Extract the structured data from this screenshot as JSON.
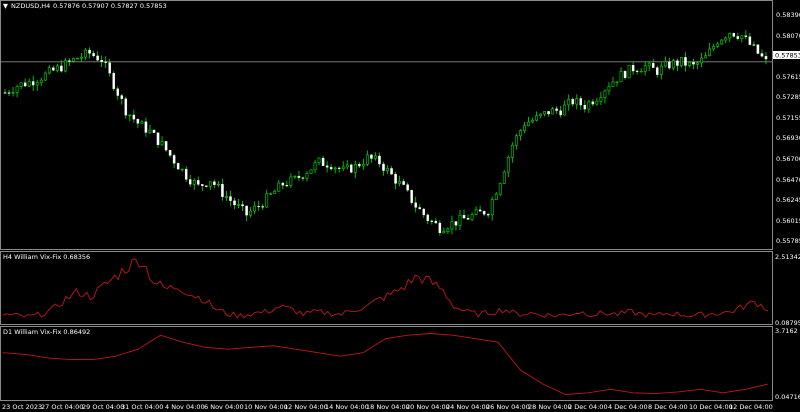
{
  "main": {
    "title": "NZDUSD,H4",
    "ohlc": "0.57876 0.57907 0.57827 0.57853",
    "price_axis": [
      "0.58390",
      "0.58070",
      "0.57615",
      "0.57285",
      "0.57155",
      "0.56930",
      "0.56700",
      "0.56470",
      "0.56245",
      "0.56015",
      "0.55785"
    ],
    "current_price": "0.57853",
    "current_price_value": 0.57853
  },
  "ind1": {
    "title": "H4 William Vix-Fix 0.68356",
    "scale_top": "2.51342",
    "scale_bottom": "0.08795"
  },
  "ind2": {
    "title": "D1 William Vix-Fix 0.86492",
    "scale_top": "3.7162",
    "scale_bottom": "0.04716"
  },
  "time_axis": [
    "23 Oct 2023",
    "27 Oct 04:00",
    "29 Oct 04:00",
    "31 Oct 04:00",
    "4 Nov 04:00",
    "6 Nov 04:00",
    "10 Nov 04:00",
    "12 Nov 04:00",
    "14 Nov 04:00",
    "18 Nov 04:00",
    "20 Nov 04:00",
    "24 Nov 04:00",
    "26 Nov 04:00",
    "28 Nov 04:00",
    "2 Dec 04:00",
    "4 Dec 04:00",
    "8 Dec 04:00",
    "10 Dec 04:00",
    "12 Dec 04:00"
  ],
  "chart_data": {
    "type": "candlestick",
    "symbol": "NZDUSD",
    "timeframe": "H4",
    "price_range": [
      0.55785,
      0.5839
    ],
    "close_path": [
      0.575,
      0.5758,
      0.5762,
      0.5768,
      0.5775,
      0.5782,
      0.579,
      0.5795,
      0.5788,
      0.576,
      0.573,
      0.5715,
      0.5705,
      0.569,
      0.5672,
      0.5655,
      0.5642,
      0.565,
      0.5635,
      0.5622,
      0.561,
      0.562,
      0.5632,
      0.5645,
      0.565,
      0.566,
      0.567,
      0.5668,
      0.566,
      0.5665,
      0.5675,
      0.567,
      0.5655,
      0.564,
      0.562,
      0.5605,
      0.5595,
      0.56,
      0.5605,
      0.561,
      0.5615,
      0.565,
      0.569,
      0.5715,
      0.572,
      0.5728,
      0.573,
      0.574,
      0.5735,
      0.5745,
      0.576,
      0.577,
      0.5778,
      0.578,
      0.5775,
      0.5782,
      0.5785,
      0.578,
      0.579,
      0.581,
      0.582,
      0.5815,
      0.58,
      0.5785
    ],
    "vixfix_h4": [
      0.3,
      0.25,
      0.2,
      0.3,
      0.5,
      0.9,
      1.2,
      1.0,
      1.4,
      1.8,
      2.2,
      2.5,
      1.6,
      1.3,
      1.4,
      1.1,
      0.9,
      0.5,
      0.3,
      0.25,
      0.35,
      0.4,
      0.6,
      0.5,
      0.3,
      0.4,
      0.35,
      0.3,
      0.5,
      0.6,
      0.9,
      1.1,
      1.4,
      1.8,
      1.6,
      1.3,
      0.6,
      0.4,
      0.3,
      0.4,
      0.5,
      0.3,
      0.35,
      0.3,
      0.25,
      0.3,
      0.4,
      0.3,
      0.35,
      0.3,
      0.4,
      0.3,
      0.25,
      0.35,
      0.3,
      0.25,
      0.3,
      0.35,
      0.4,
      0.6,
      0.8,
      0.5
    ],
    "vixfix_d1": [
      2.6,
      2.5,
      2.3,
      2.2,
      2.2,
      2.4,
      2.8,
      3.6,
      3.2,
      2.9,
      2.8,
      2.9,
      3.0,
      2.8,
      2.6,
      2.4,
      2.6,
      3.4,
      3.6,
      3.7,
      3.6,
      3.4,
      3.2,
      1.6,
      0.8,
      0.2,
      0.3,
      0.5,
      0.3,
      0.25,
      0.35,
      0.5,
      0.3,
      0.5,
      0.8
    ]
  }
}
